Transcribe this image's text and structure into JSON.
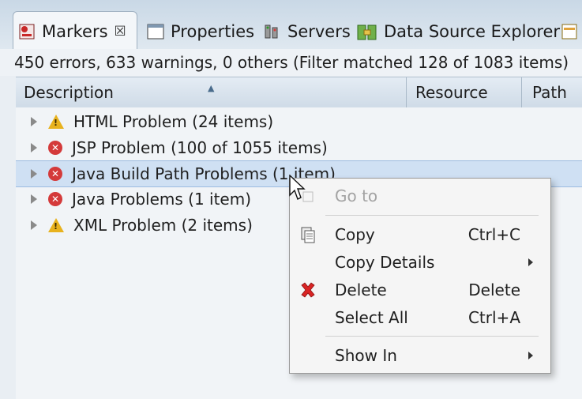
{
  "tabs": [
    {
      "label": "Markers",
      "icon": "markers-icon",
      "active": true
    },
    {
      "label": "Properties",
      "icon": "properties-icon"
    },
    {
      "label": "Servers",
      "icon": "servers-icon"
    },
    {
      "label": "Data Source Explorer",
      "icon": "data-source-icon"
    }
  ],
  "status": "450 errors, 633 warnings, 0 others (Filter matched 128 of 1083 items)",
  "columns": {
    "description": "Description",
    "resource": "Resource",
    "path": "Path"
  },
  "rows": [
    {
      "label": "HTML Problem (24 items)",
      "severity": "warning"
    },
    {
      "label": "JSP Problem (100 of 1055 items)",
      "severity": "error"
    },
    {
      "label": "Java Build Path Problems (1 item)",
      "severity": "error",
      "selected": true
    },
    {
      "label": "Java Problems (1 item)",
      "severity": "error"
    },
    {
      "label": "XML Problem (2 items)",
      "severity": "warning"
    }
  ],
  "menu": {
    "goto": "Go to",
    "copy": "Copy",
    "copy_sc": "Ctrl+C",
    "copy_details": "Copy Details",
    "delete": "Delete",
    "delete_sc": "Delete",
    "select_all": "Select All",
    "select_all_sc": "Ctrl+A",
    "show_in": "Show In"
  },
  "colors": {
    "error": "#d43a3a",
    "warning": "#e8b21e",
    "selection": "#cfe0f3",
    "delete_icon": "#d92424"
  }
}
